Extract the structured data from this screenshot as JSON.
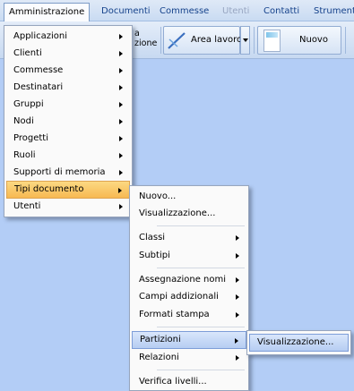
{
  "menubar": {
    "items": [
      {
        "label": "Amministrazione",
        "state": "active"
      },
      {
        "label": "Documenti",
        "state": "normal"
      },
      {
        "label": "Commesse",
        "state": "normal"
      },
      {
        "label": "Utenti",
        "state": "disabled"
      },
      {
        "label": "Contatti",
        "state": "normal"
      },
      {
        "label": "Strumenti",
        "state": "normal"
      }
    ]
  },
  "toolbar": {
    "fragment_line1": "a",
    "fragment_line2": "zione",
    "area_lavoro_label": "Area lavoro",
    "nuovo_label": "Nuovo"
  },
  "menu_amministrazione": {
    "items": [
      {
        "label": "Applicazioni",
        "submenu": true
      },
      {
        "label": "Clienti",
        "submenu": true
      },
      {
        "label": "Commesse",
        "submenu": true
      },
      {
        "label": "Destinatari",
        "submenu": true
      },
      {
        "label": "Gruppi",
        "submenu": true
      },
      {
        "label": "Nodi",
        "submenu": true
      },
      {
        "label": "Progetti",
        "submenu": true
      },
      {
        "label": "Ruoli",
        "submenu": true
      },
      {
        "label": "Supporti di memoria",
        "submenu": true
      },
      {
        "label": "Tipi documento",
        "submenu": true,
        "highlighted": true
      },
      {
        "label": "Utenti",
        "submenu": true
      }
    ]
  },
  "menu_tipi_documento": {
    "items": [
      {
        "label": "Nuovo..."
      },
      {
        "label": "Visualizzazione..."
      },
      {
        "label": "Classi",
        "submenu": true
      },
      {
        "label": "Subtipi",
        "submenu": true
      },
      {
        "label": "Assegnazione nomi",
        "submenu": true
      },
      {
        "label": "Campi addizionali",
        "submenu": true
      },
      {
        "label": "Formati stampa",
        "submenu": true
      },
      {
        "label": "Partizioni",
        "submenu": true,
        "highlighted": true
      },
      {
        "label": "Relazioni",
        "submenu": true
      },
      {
        "label": "Verifica livelli..."
      }
    ]
  },
  "menu_partizioni": {
    "items": [
      {
        "label": "Visualizzazione...",
        "highlighted": true
      }
    ]
  },
  "colors": {
    "background": "#b3cdf6",
    "menu_highlight": "#f7b952",
    "menubar_text": "#15428b"
  }
}
